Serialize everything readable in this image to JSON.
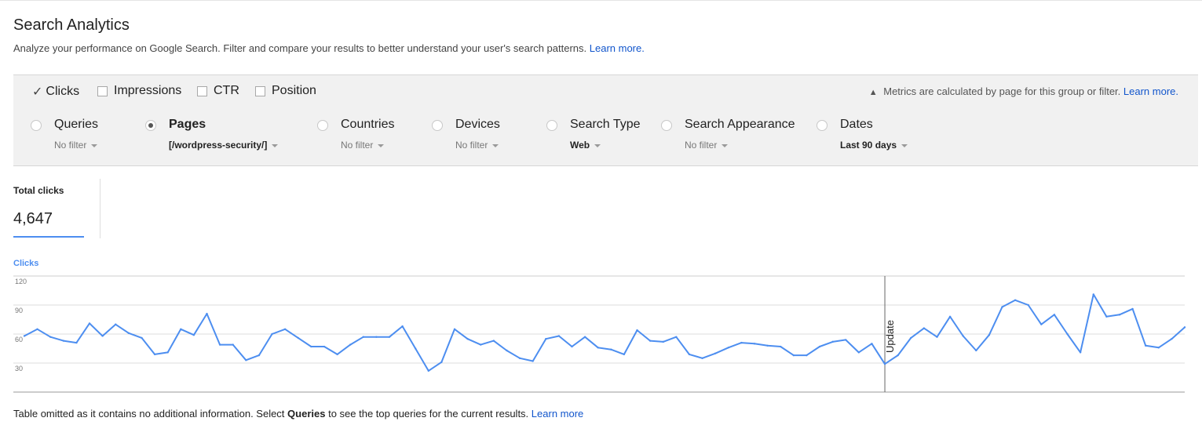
{
  "header": {
    "title": "Search Analytics",
    "subtitle": "Analyze your performance on Google Search. Filter and compare your results to better understand your user's search patterns.",
    "learn_more": "Learn more."
  },
  "metrics": {
    "items": [
      {
        "label": "Clicks",
        "checked": true
      },
      {
        "label": "Impressions",
        "checked": false
      },
      {
        "label": "CTR",
        "checked": false
      },
      {
        "label": "Position",
        "checked": false
      }
    ],
    "note": "Metrics are calculated by page for this group or filter.",
    "note_link": "Learn more."
  },
  "filters": [
    {
      "label": "Queries",
      "value": "No filter",
      "selected": false
    },
    {
      "label": "Pages",
      "value": "[/wordpress-security/]",
      "selected": true
    },
    {
      "label": "Countries",
      "value": "No filter",
      "selected": false
    },
    {
      "label": "Devices",
      "value": "No filter",
      "selected": false
    },
    {
      "label": "Search Type",
      "value": "Web",
      "selected": false
    },
    {
      "label": "Search Appearance",
      "value": "No filter",
      "selected": false
    },
    {
      "label": "Dates",
      "value": "Last 90 days",
      "selected": false
    }
  ],
  "total": {
    "label": "Total clicks",
    "value": "4,647"
  },
  "chart_data": {
    "type": "line",
    "ylabel": "Clicks",
    "yticks": [
      30,
      60,
      90,
      120
    ],
    "ylim": [
      0,
      120
    ],
    "grid": true,
    "annotation": {
      "label": "Update",
      "index": 66
    },
    "series": [
      {
        "color": "#4d8ef0",
        "values": [
          58,
          65,
          57,
          53,
          51,
          71,
          58,
          70,
          61,
          56,
          39,
          41,
          65,
          59,
          81,
          49,
          49,
          33,
          38,
          60,
          65,
          56,
          47,
          47,
          39,
          49,
          57,
          57,
          57,
          68,
          45,
          22,
          31,
          65,
          55,
          49,
          53,
          43,
          35,
          32,
          55,
          58,
          47,
          57,
          46,
          44,
          39,
          64,
          53,
          52,
          57,
          39,
          35,
          40,
          46,
          51,
          50,
          48,
          47,
          38,
          38,
          47,
          52,
          54,
          41,
          50,
          29,
          38,
          56,
          66,
          57,
          78,
          58,
          43,
          59,
          88,
          95,
          90,
          70,
          80,
          60,
          41,
          101,
          78,
          80,
          86,
          48,
          46,
          55,
          67
        ]
      }
    ]
  },
  "footer": {
    "text1": "Table omitted as it contains no additional information. Select ",
    "bold": "Queries",
    "text2": " to see the top queries for the current results.",
    "link": "Learn more"
  }
}
